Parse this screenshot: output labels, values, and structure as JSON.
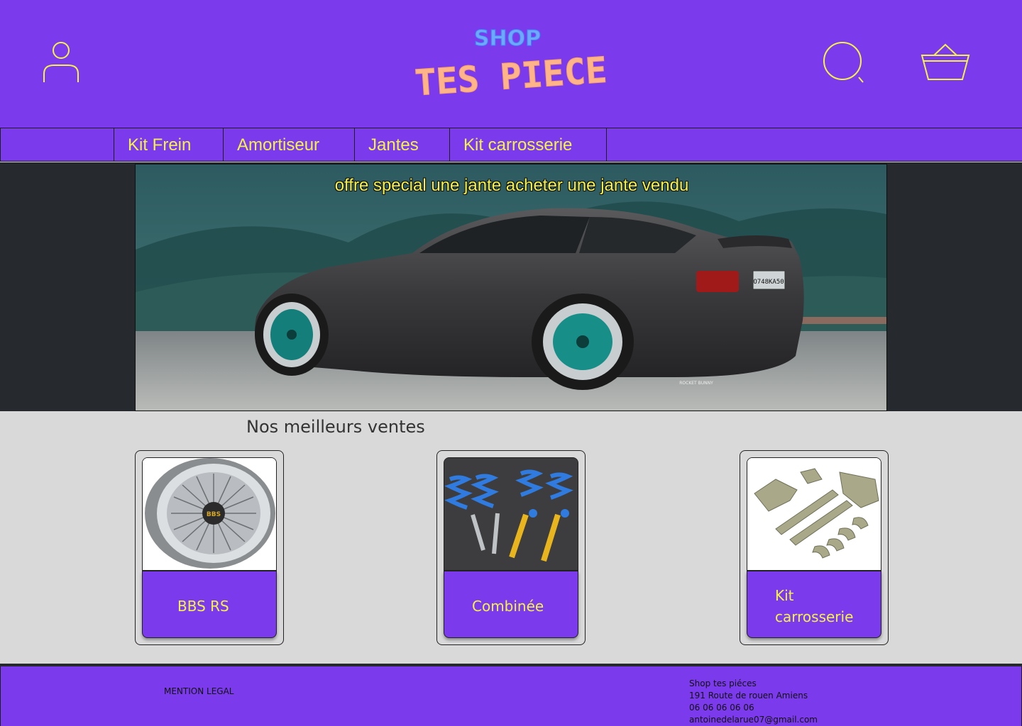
{
  "header": {
    "logo_small": "SHOP",
    "logo_big": "TES PIECE",
    "colors": {
      "purple": "#7c3aed",
      "yellow": "#f4f24a"
    }
  },
  "nav": {
    "items": [
      {
        "label": ""
      },
      {
        "label": "Kit Frein"
      },
      {
        "label": "Amortiseur"
      },
      {
        "label": "Jantes"
      },
      {
        "label": "Kit carrosserie"
      }
    ]
  },
  "hero": {
    "promo": "offre special une jante acheter une jante vendu",
    "plate": "O748KA50",
    "badge": "ROCKET BUNNY"
  },
  "best_sellers": {
    "title": "Nos meilleurs ventes",
    "products": [
      {
        "name": "BBS RS",
        "image": "wheel-image",
        "logo": "BBS"
      },
      {
        "name": "Combinée",
        "image": "coilover-image"
      },
      {
        "name_line1": "Kit",
        "name_line2": "carrosserie",
        "image": "bodykit-image"
      }
    ]
  },
  "footer": {
    "mention": "MENTION LEGAL",
    "contact": [
      "Shop tes piéces",
      "191 Route de rouen Amiens",
      "06 06 06 06 06",
      "antoinedelarue07@gmail.com"
    ]
  }
}
